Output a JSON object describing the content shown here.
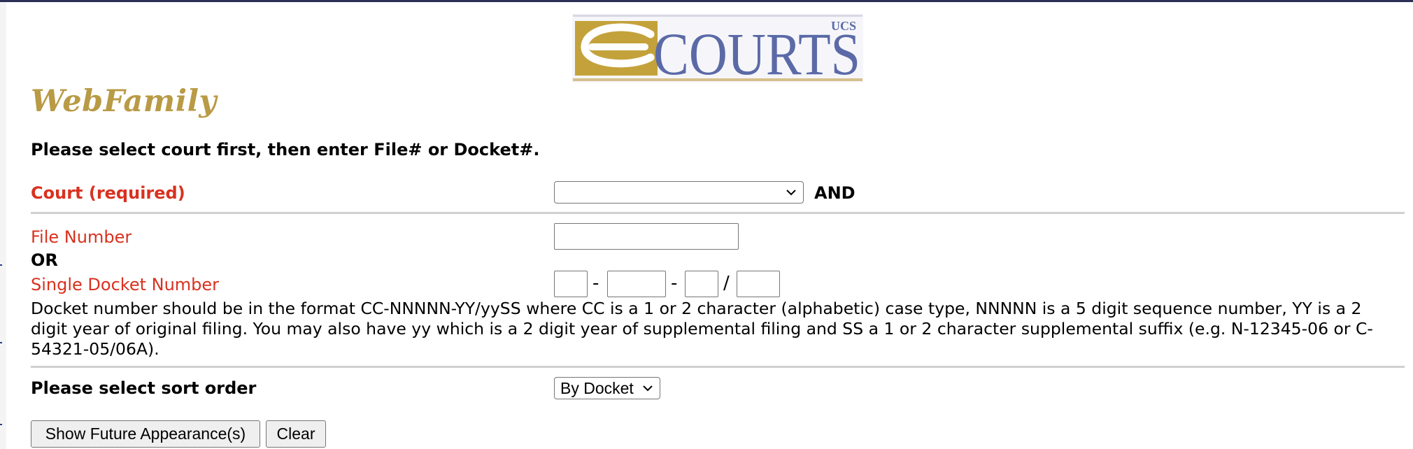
{
  "header": {
    "logo_alt": "UCS COURTS",
    "logo_prefix": "UCS",
    "logo_word": "COURTS",
    "brand": "WebFamily"
  },
  "instructions": "Please select court first, then enter File# or Docket#.",
  "court": {
    "label": "Court (required)",
    "selected": "",
    "and_text": "AND"
  },
  "file_number": {
    "label": "File Number",
    "value": ""
  },
  "or_text": "OR",
  "docket": {
    "label": "Single Docket Number",
    "sep1": "-",
    "sep2": "-",
    "sep3": "/",
    "help": "Docket number should be in the format CC-NNNNN-YY/yySS where CC is a 1 or 2 character (alphabetic) case type, NNNNN is a 5 digit sequence number, YY is a 2 digit year of original filing. You may also have yy which is a 2 digit year of supplemental filing and SS a 1 or 2 character supplemental suffix (e.g. N-12345-06 or C-54321-05/06A)."
  },
  "sort": {
    "label": "Please select sort order",
    "selected": "By Docket"
  },
  "buttons": {
    "show": "Show Future Appearance(s)",
    "clear": "Clear"
  },
  "colors": {
    "label_red": "#d9311f",
    "brand_gold": "#b99a45",
    "logo_blue": "#5b6aa7",
    "logo_gold": "#c4a23b"
  }
}
